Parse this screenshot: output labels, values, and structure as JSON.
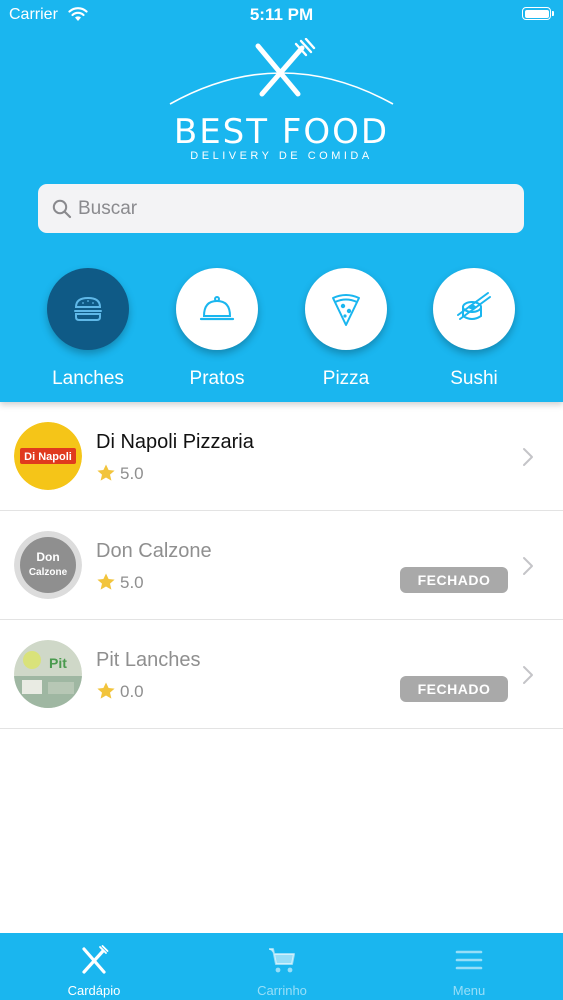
{
  "status_bar": {
    "carrier": "Carrier",
    "time": "5:11 PM"
  },
  "brand": {
    "title": "BEST FOOD",
    "subtitle": "DELIVERY DE COMIDA",
    "primary_color": "#1ab6ef",
    "active_category_color": "#0f5a86"
  },
  "search": {
    "placeholder": "Buscar",
    "value": ""
  },
  "categories": [
    {
      "label": "Lanches",
      "icon": "burger-icon",
      "active": true
    },
    {
      "label": "Pratos",
      "icon": "cloche-icon",
      "active": false
    },
    {
      "label": "Pizza",
      "icon": "pizza-slice-icon",
      "active": false
    },
    {
      "label": "Sushi",
      "icon": "sushi-icon",
      "active": false
    }
  ],
  "restaurants": [
    {
      "name": "Di Napoli Pizzaria",
      "rating": "5.0",
      "status": "",
      "logo_text": "Di Napoli"
    },
    {
      "name": "Don Calzone",
      "rating": "5.0",
      "status": "FECHADO",
      "logo_text": "Don Calzone"
    },
    {
      "name": "Pit Lanches",
      "rating": "0.0",
      "status": "FECHADO",
      "logo_text": "Pit"
    }
  ],
  "tabbar": [
    {
      "label": "Cardápio",
      "icon": "fork-knife-icon",
      "active": true
    },
    {
      "label": "Carrinho",
      "icon": "cart-icon",
      "active": false
    },
    {
      "label": "Menu",
      "icon": "hamburger-menu-icon",
      "active": false
    }
  ]
}
